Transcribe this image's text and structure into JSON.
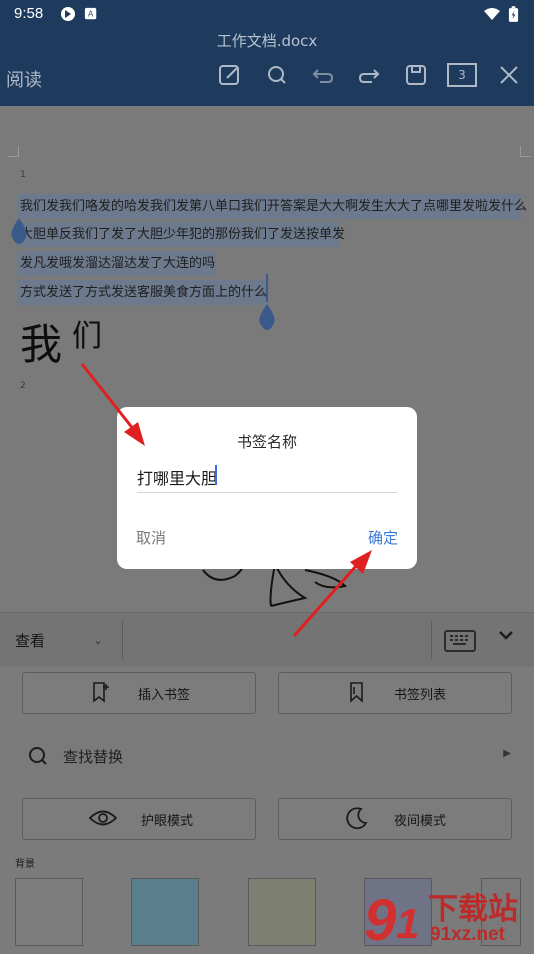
{
  "status_bar": {
    "time": "9:58"
  },
  "header": {
    "doc_title": "工作文档.docx",
    "mode_label": "阅读",
    "page_count": "3"
  },
  "document": {
    "page1_number": "1",
    "page2_number": "2",
    "lines": [
      "我们发我们咯发的哈发我们发第八单口我们开答案是大大啊发生大大了点哪里发啦发什么",
      "大胆单反我们了发了大胆少年犯的那份我们了发送按单发",
      "发凡发哦发溜达溜达发了大连的吗",
      "方式发送了方式发送客服美食方面上的什么"
    ],
    "handwriting_big": "我",
    "handwriting_small": "们"
  },
  "dialog": {
    "title": "书签名称",
    "input_value": "打哪里大胆",
    "cancel_label": "取消",
    "confirm_label": "确定"
  },
  "toolbar": {
    "view_label": "查看"
  },
  "panel": {
    "insert_bookmark": "插入书签",
    "bookmark_list": "书签列表",
    "find_replace": "查找替换",
    "eye_mode": "护眼模式",
    "night_mode": "夜间模式",
    "background_label": "背景",
    "swatch_colors": [
      "#7d7d7d",
      "#5b7e8c",
      "#7d7f71",
      "#6f7385",
      "#7a7a7a"
    ]
  },
  "watermark": {
    "text": "下载站",
    "url": "91xz.net"
  },
  "colors": {
    "header_bg": "#1e3a5c",
    "accent": "#3a78d8",
    "arrow": "#e02020"
  }
}
